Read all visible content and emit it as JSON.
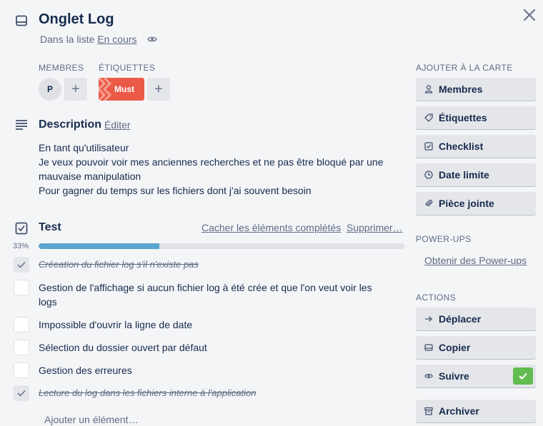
{
  "header": {
    "title": "Onglet Log",
    "in_list_prefix": "Dans la liste",
    "list_name": "En cours"
  },
  "members": {
    "heading": "MEMBRES",
    "avatar_initial": "P",
    "add": "+"
  },
  "labels": {
    "heading": "ÉTIQUETTES",
    "tag": "Must",
    "tag_color": "#eb5a46",
    "add": "+"
  },
  "description": {
    "title": "Description",
    "edit": "Éditer",
    "lines": [
      "En tant qu'utilisateur",
      "Je veux pouvoir voir mes anciennes recherches et ne pas être bloqué par une",
      "mauvaise manipulation",
      "Pour gagner du temps sur les fichiers dont j'ai souvent besoin"
    ]
  },
  "checklist": {
    "title": "Test",
    "hide_completed": "Cacher les éléments complétés",
    "delete": "Supprimer…",
    "progress_label": "33%",
    "progress_fraction": 0.33,
    "progress_color": "#5ba4cf",
    "items": [
      {
        "text": "Créeation du fichier log s'il n'existe pas",
        "done": true
      },
      {
        "text_line1": "Gestion de l'affichage si aucun fichier log à été crée et que l'on veut voir les",
        "text_line2": "logs",
        "done": false
      },
      {
        "text": "Impossible d'ouvrir la ligne de date",
        "done": false
      },
      {
        "text": "Sélection du dossier ouvert par défaut",
        "done": false
      },
      {
        "text": "Gestion des erreures",
        "done": false
      },
      {
        "text": "Lecture du log dans les fichiers interne à l'application",
        "done": true
      }
    ],
    "add_item": "Ajouter un élément…"
  },
  "sidebar": {
    "add_heading": "AJOUTER À LA CARTE",
    "add_buttons": [
      {
        "label": "Membres",
        "icon": "person-icon"
      },
      {
        "label": "Étiquettes",
        "icon": "tag-icon"
      },
      {
        "label": "Checklist",
        "icon": "checkbox-icon"
      },
      {
        "label": "Date limite",
        "icon": "clock-icon"
      },
      {
        "label": "Pièce jointe",
        "icon": "paperclip-icon"
      }
    ],
    "powerups_heading": "POWER-UPS",
    "powerups_link": "Obtenir des Power-ups",
    "actions_heading": "ACTIONS",
    "action_buttons": [
      {
        "label": "Déplacer",
        "icon": "arrow-right-icon"
      },
      {
        "label": "Copier",
        "icon": "card-icon"
      },
      {
        "label": "Suivre",
        "icon": "eye-icon",
        "active": true
      },
      {
        "label": "Archiver",
        "icon": "archive-icon"
      }
    ],
    "active_color": "#61bd4f"
  }
}
